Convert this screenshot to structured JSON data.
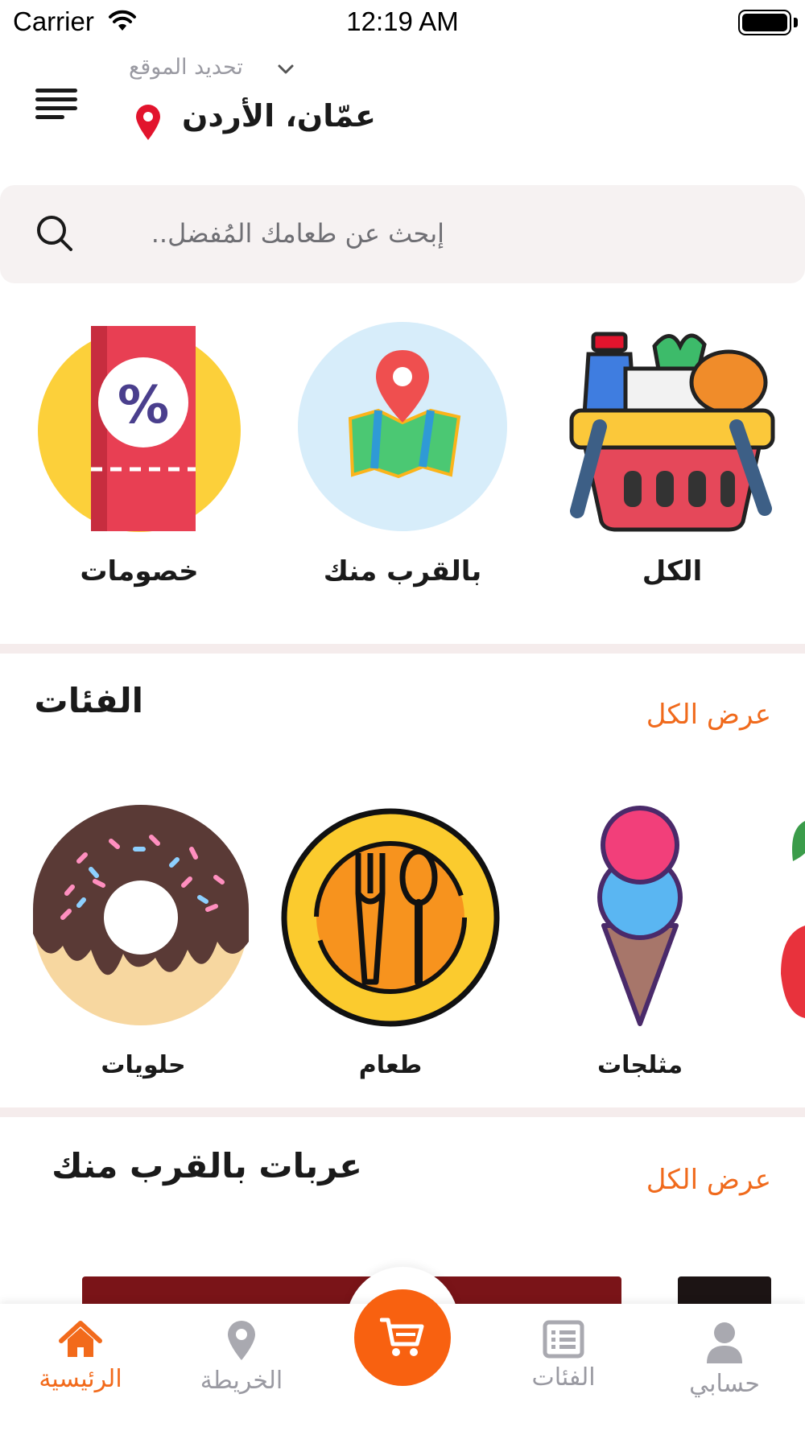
{
  "status_bar": {
    "carrier": "Carrier",
    "time": "12:19 AM"
  },
  "header": {
    "location_hint": "تحديد الموقع",
    "location_name": "عمّان، الأردن"
  },
  "search": {
    "placeholder": "إبحث عن طعامك المُفضل.."
  },
  "quick_filters": [
    {
      "label": "الكل",
      "icon": "grocery-basket-icon"
    },
    {
      "label": "بالقرب منك",
      "icon": "map-pin-icon"
    },
    {
      "label": "خصومات",
      "icon": "discount-ticket-icon"
    }
  ],
  "categories_section": {
    "title": "الفئات",
    "view_all": "عرض الكل",
    "items": [
      {
        "label": "مثلجات",
        "icon": "ice-cream-icon"
      },
      {
        "label": "طعام",
        "icon": "plate-cutlery-icon"
      },
      {
        "label": "حلويات",
        "icon": "donut-icon"
      }
    ]
  },
  "nearby_section": {
    "title": "عربات بالقرب منك",
    "view_all": "عرض الكل"
  },
  "bottom_nav": {
    "items": [
      {
        "label": "حسابي",
        "icon": "user-icon"
      },
      {
        "label": "الفئات",
        "icon": "list-icon"
      },
      {
        "label": "",
        "icon": "cart-icon"
      },
      {
        "label": "الخريطة",
        "icon": "map-pin-icon"
      },
      {
        "label": "الرئيسية",
        "icon": "home-icon",
        "active": true
      }
    ]
  },
  "colors": {
    "accent": "#f26a1b",
    "search_bg": "#f6f2f2",
    "divider": "#f5ecec"
  }
}
